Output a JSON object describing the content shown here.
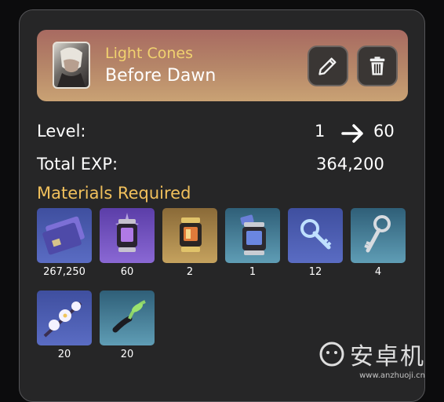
{
  "header": {
    "category": "Light Cones",
    "name": "Before Dawn",
    "edit_icon": "pencil-icon",
    "delete_icon": "trash-icon"
  },
  "level": {
    "label": "Level:",
    "from": "1",
    "to": "60",
    "arrow_icon": "arrow-right-icon"
  },
  "exp": {
    "label": "Total EXP:",
    "value": "364,200"
  },
  "materials": {
    "title": "Materials Required",
    "items": [
      {
        "icon": "exp-card-icon",
        "count": "267,250"
      },
      {
        "icon": "purple-lantern-icon",
        "count": "60"
      },
      {
        "icon": "gold-lantern-icon",
        "count": "2"
      },
      {
        "icon": "blue-lantern-icon",
        "count": "1"
      },
      {
        "icon": "blue-key-icon",
        "count": "12"
      },
      {
        "icon": "silver-key-icon",
        "count": "4"
      },
      {
        "icon": "flower-branch-icon",
        "count": "20"
      },
      {
        "icon": "green-sprout-icon",
        "count": "20"
      }
    ]
  },
  "watermark": {
    "main": "安卓机",
    "sub": "www.anzhuoji.cn"
  },
  "colors": {
    "panel_bg": "#262627",
    "accent_gold": "#f1c05c",
    "category_yellow": "#f1d26f"
  }
}
